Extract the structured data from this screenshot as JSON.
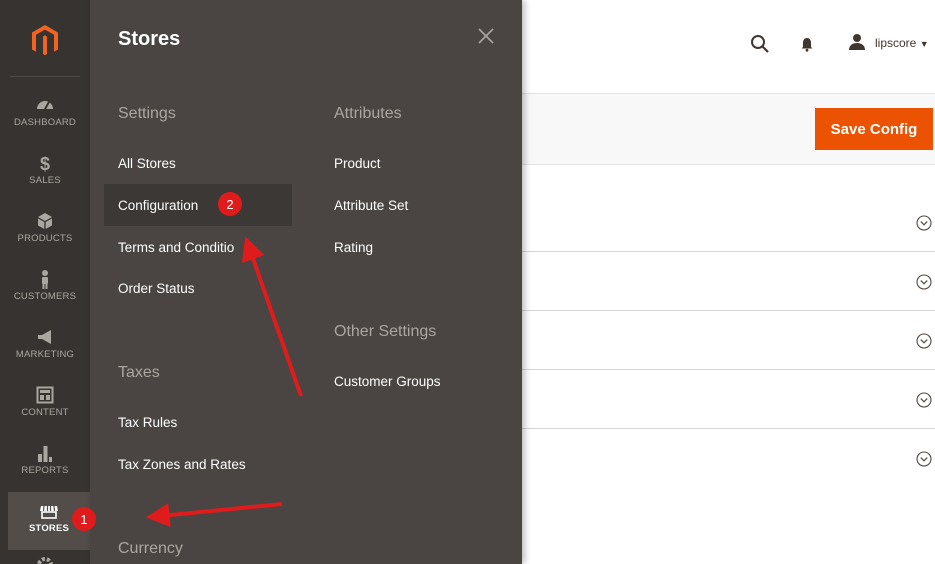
{
  "nav": {
    "items": [
      {
        "label": "DASHBOARD",
        "icon": "dashboard-icon"
      },
      {
        "label": "SALES",
        "icon": "dollar-icon"
      },
      {
        "label": "PRODUCTS",
        "icon": "cube-icon"
      },
      {
        "label": "CUSTOMERS",
        "icon": "person-icon"
      },
      {
        "label": "MARKETING",
        "icon": "megaphone-icon"
      },
      {
        "label": "CONTENT",
        "icon": "layout-icon"
      },
      {
        "label": "REPORTS",
        "icon": "bar-chart-icon"
      },
      {
        "label": "STORES",
        "icon": "storefront-icon"
      }
    ]
  },
  "header": {
    "user_name": "lipscore"
  },
  "toolbar": {
    "save_label": "Save Config"
  },
  "flyout": {
    "title": "Stores",
    "settings_title": "Settings",
    "settings_links": [
      "All Stores",
      "Configuration",
      "Terms and Conditio",
      "Order Status"
    ],
    "taxes_title": "Taxes",
    "taxes_links": [
      "Tax Rules",
      "Tax Zones and Rates"
    ],
    "currency_title": "Currency",
    "attributes_title": "Attributes",
    "attributes_links": [
      "Product",
      "Attribute Set",
      "Rating"
    ],
    "other_title": "Other Settings",
    "other_links": [
      "Customer Groups"
    ]
  },
  "annotations": {
    "badge_1": "1",
    "badge_2": "2",
    "color": "#e01b1b"
  },
  "colors": {
    "accent": "#eb5202",
    "nav_bg": "#373330",
    "flyout_bg": "#4a4542"
  }
}
